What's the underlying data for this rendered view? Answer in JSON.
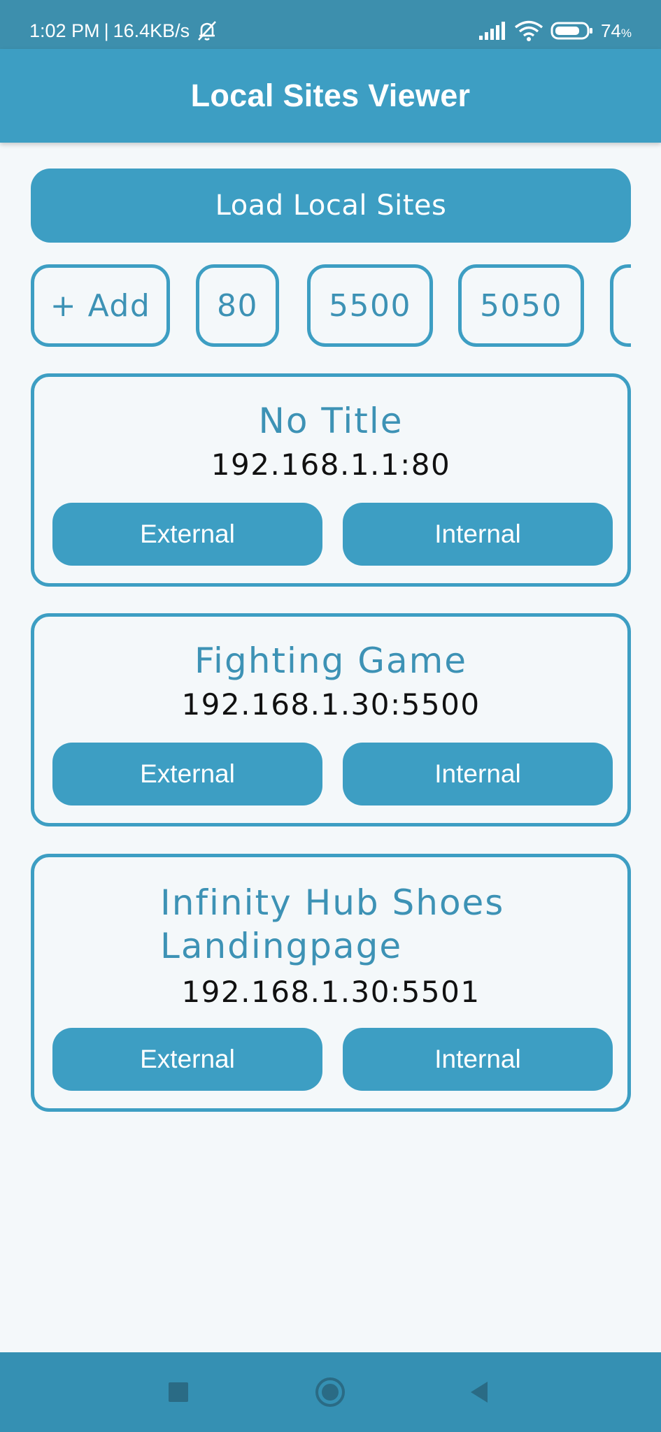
{
  "status_bar": {
    "time": "1:02 PM",
    "separator": "|",
    "network_speed": "16.4KB/s",
    "battery_percent": "74",
    "battery_unit": "%"
  },
  "app_bar": {
    "title": "Local Sites Viewer"
  },
  "load_button": {
    "label": "Load Local Sites"
  },
  "ports": {
    "add_label": "+ Add",
    "items": [
      "80",
      "5500",
      "5050"
    ]
  },
  "sites": [
    {
      "title": "No Title",
      "address": "192.168.1.1:80",
      "external_label": "External",
      "internal_label": "Internal"
    },
    {
      "title": "Fighting Game",
      "address": "192.168.1.30:5500",
      "external_label": "External",
      "internal_label": "Internal"
    },
    {
      "title": "Infinity Hub Shoes Landingpage",
      "address": "192.168.1.30:5501",
      "external_label": "External",
      "internal_label": "Internal"
    }
  ],
  "nav_bar": {
    "icons": [
      "recent-apps-icon",
      "home-icon",
      "back-icon"
    ]
  },
  "colors": {
    "primary": "#3d9ec3",
    "status_bar": "#3d8fad",
    "nav_bar": "#3590b3",
    "background": "#f4f8fa",
    "title_text": "#3d92b5"
  }
}
